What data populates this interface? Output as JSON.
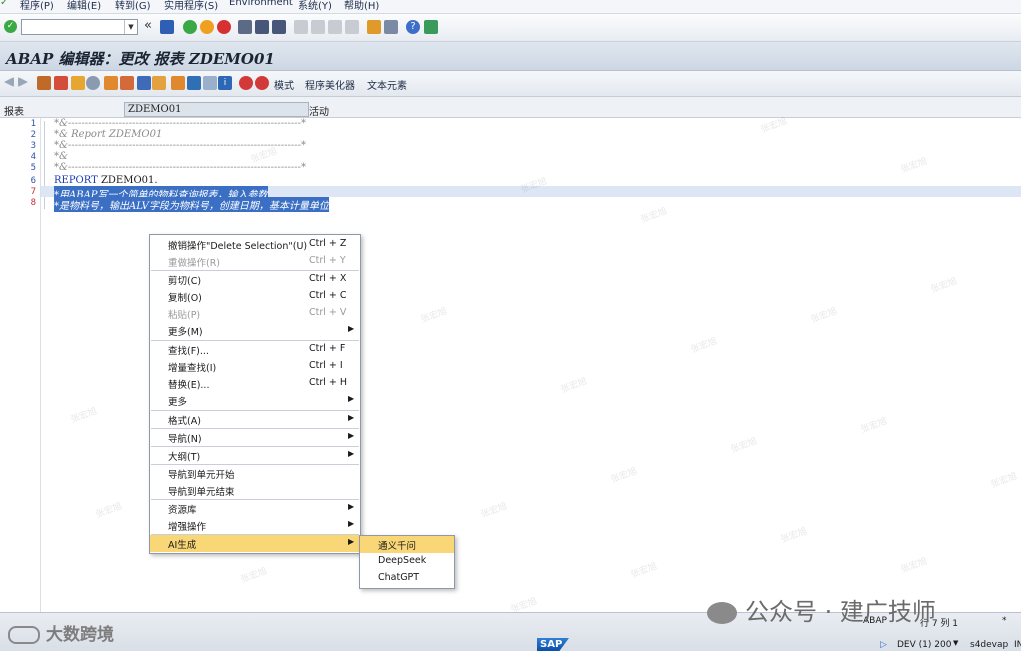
{
  "menubar": {
    "items": [
      "程序(P)",
      "编辑(E)",
      "转到(G)",
      "实用程序(S)",
      "Environment",
      "系统(Y)",
      "帮助(H)"
    ]
  },
  "toolbar": {
    "command_field_value": "",
    "icons": [
      "enter-icon",
      "save-icon",
      "back-icon",
      "exit-icon",
      "cancel-icon",
      "print-icon",
      "find-icon",
      "find-next-icon",
      "first-page-icon",
      "prev-page-icon",
      "next-page-icon",
      "last-page-icon",
      "new-session-icon",
      "shortcut-icon",
      "help-icon",
      "customize-icon"
    ]
  },
  "title": "ABAP 编辑器：更改 报表 ZDEMO01",
  "app_toolbar": {
    "buttons": [
      "模式",
      "程序美化器",
      "文本元素"
    ]
  },
  "header": {
    "type_label": "报表",
    "program_name": "ZDEMO01",
    "status": "活动"
  },
  "editor": {
    "lines": [
      {
        "num": "1",
        "text": "*&---------------------------------------------------------------------*",
        "kind": "comment"
      },
      {
        "num": "2",
        "text": "*& Report ZDEMO01",
        "kind": "comment"
      },
      {
        "num": "3",
        "text": "*&---------------------------------------------------------------------*",
        "kind": "comment"
      },
      {
        "num": "4",
        "text": "*&",
        "kind": "comment"
      },
      {
        "num": "5",
        "text": "*&---------------------------------------------------------------------*",
        "kind": "comment"
      },
      {
        "num": "6",
        "kw": "REPORT",
        "text": " ZDEMO01.",
        "kind": "code"
      },
      {
        "num": "7",
        "text": "*用ABAP写一个简单的物料查询报表，输入参数",
        "kind": "selected"
      },
      {
        "num": "8",
        "text": "*是物料号，输出ALV字段为物料号，创建日期，基本计量单位",
        "kind": "selected"
      }
    ]
  },
  "context_menu": {
    "items": [
      {
        "label": "撤销操作\"Delete Selection\"(U)",
        "shortcut": "Ctrl + Z"
      },
      {
        "label": "重做操作(R)",
        "shortcut": "Ctrl + Y"
      },
      {
        "label": "剪切(C)",
        "shortcut": "Ctrl + X"
      },
      {
        "label": "复制(O)",
        "shortcut": "Ctrl + C"
      },
      {
        "label": "粘贴(P)",
        "shortcut": "Ctrl + V"
      },
      {
        "label": "更多(M)",
        "shortcut": ""
      },
      {
        "label": "查找(F)...",
        "shortcut": "Ctrl + F"
      },
      {
        "label": "增量查找(I)",
        "shortcut": "Ctrl + I"
      },
      {
        "label": "替换(E)...",
        "shortcut": "Ctrl + H"
      },
      {
        "label": "更多",
        "shortcut": ""
      },
      {
        "label": "格式(A)",
        "shortcut": ""
      },
      {
        "label": "导航(N)",
        "shortcut": ""
      },
      {
        "label": "大纲(T)",
        "shortcut": ""
      },
      {
        "label": "导航到单元开始",
        "shortcut": ""
      },
      {
        "label": "导航到单元结束",
        "shortcut": ""
      },
      {
        "label": "资源库",
        "shortcut": ""
      },
      {
        "label": "增强操作",
        "shortcut": ""
      },
      {
        "label": "AI生成",
        "shortcut": ""
      }
    ],
    "submenu_arrow": "▶"
  },
  "ai_submenu": {
    "items": [
      "通义千问",
      "DeepSeek",
      "ChatGPT"
    ]
  },
  "statusbar": {
    "language": "ABAP",
    "position": "行 7 列 1",
    "mode": "*",
    "system": "DEV (1) 200",
    "server": "s4devap",
    "ins": "IN",
    "logo": "SAP"
  },
  "watermarks": {
    "repeat_text": "张宏旭",
    "brand": "公众号 · 建广技师",
    "left_brand": "大数跨境"
  },
  "colors": {
    "selection": "#3a6fc4",
    "menu_highlight": "#f9d777",
    "line_numbers": "#2a56a8",
    "keyword": "#1a3bb3"
  }
}
